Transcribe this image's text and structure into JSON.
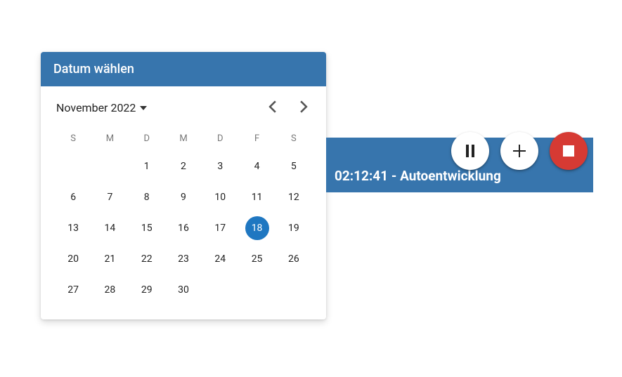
{
  "colors": {
    "primary": "#3775ad",
    "accent_red": "#d63a33"
  },
  "datepicker": {
    "title": "Datum wählen",
    "month_label": "November 2022",
    "weekdays": [
      "S",
      "M",
      "D",
      "M",
      "D",
      "F",
      "S"
    ],
    "days": [
      1,
      2,
      3,
      4,
      5,
      6,
      7,
      8,
      9,
      10,
      11,
      12,
      13,
      14,
      15,
      16,
      17,
      18,
      19,
      20,
      21,
      22,
      23,
      24,
      25,
      26,
      27,
      28,
      29,
      30
    ],
    "selected_day": 18
  },
  "timer": {
    "elapsed": "02:12:41",
    "separator": " - ",
    "task": "Autoentwicklung",
    "buttons": {
      "pause_icon": "pause-icon",
      "add_icon": "plus-icon",
      "stop_icon": "stop-icon"
    }
  }
}
